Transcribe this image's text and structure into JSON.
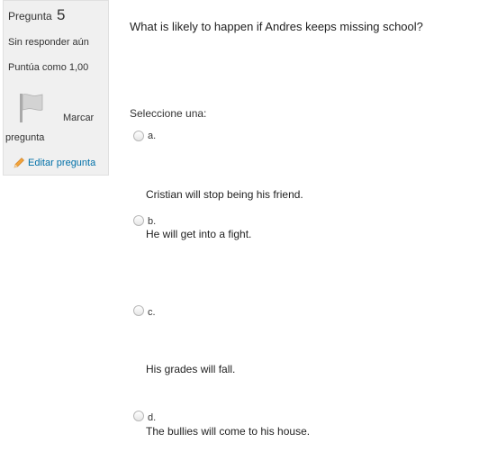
{
  "question_info": {
    "label": "Pregunta",
    "number": "5",
    "state": "Sin responder aún",
    "grade": "Puntúa como 1,00",
    "flag_label_line1": "Marcar",
    "flag_label_line2": "pregunta",
    "flag_icon": "flag-icon",
    "edit_label": "Editar pregunta",
    "edit_icon": "pencil-icon"
  },
  "question": {
    "text": "What is likely to happen if Andres keeps missing school?",
    "prompt": "Seleccione una:"
  },
  "answers": [
    {
      "letter": "a.",
      "text": "Cristian will stop being his friend."
    },
    {
      "letter": "b.",
      "text": "He will get into a fight."
    },
    {
      "letter": "c.",
      "text": "His grades will fall."
    },
    {
      "letter": "d.",
      "text": "The bullies will come to his house."
    }
  ],
  "colors": {
    "info_background": "#f0f0f0",
    "link": "#0070a8"
  }
}
